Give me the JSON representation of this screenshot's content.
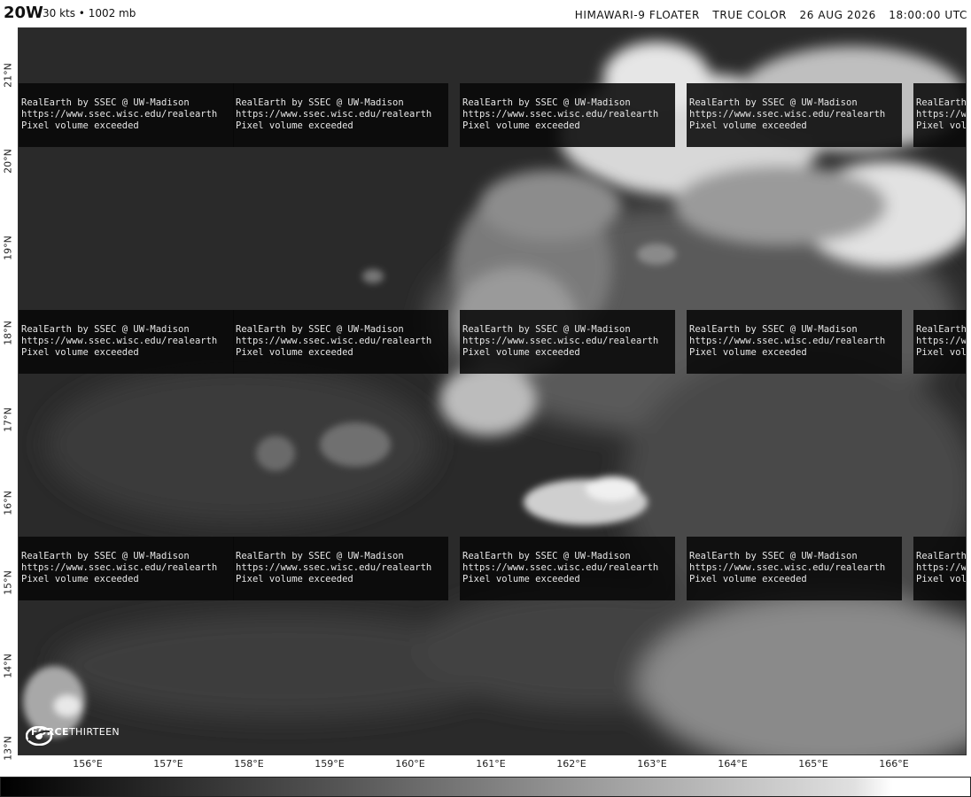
{
  "header": {
    "storm_id": "20W",
    "storm_info": "30 kts • 1002 mb",
    "satellite": "HIMAWARI-9 FLOATER",
    "product": "TRUE COLOR",
    "date": "26 AUG 2026",
    "time": "18:00:00 UTC"
  },
  "watermark": {
    "line1": "RealEarth by SSEC @ UW-Madison",
    "line2": "https://www.ssec.wisc.edu/realearth",
    "line3": "Pixel volume exceeded"
  },
  "logo": {
    "icon": "force-thirteen-logo-icon",
    "brand_bold": "FORCE",
    "brand_rest": "THIRTEEN"
  },
  "axes": {
    "latitudes": [
      "21°N",
      "20°N",
      "19°N",
      "18°N",
      "17°N",
      "16°N",
      "15°N",
      "14°N",
      "13°N"
    ],
    "longitudes": [
      "156°E",
      "157°E",
      "158°E",
      "159°E",
      "160°E",
      "161°E",
      "162°E",
      "163°E",
      "164°E",
      "165°E",
      "166°E"
    ]
  },
  "colors": {
    "ocean": "#2b2b2b",
    "cloud": "#e8e8e8",
    "watermark_bg": "#080808"
  }
}
